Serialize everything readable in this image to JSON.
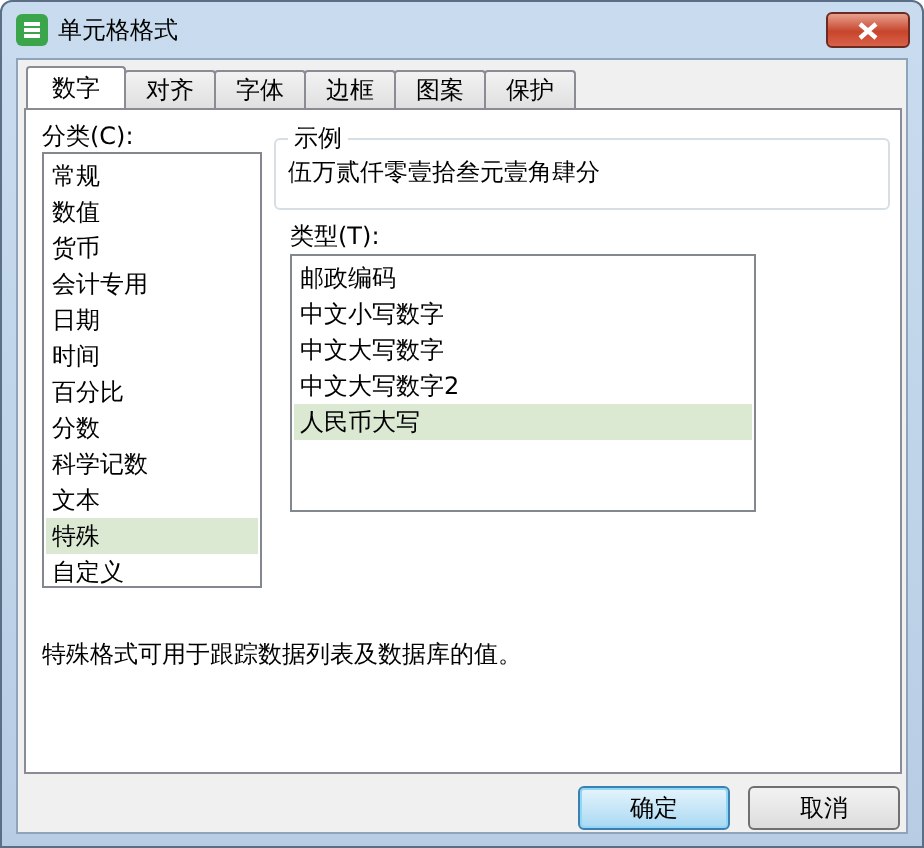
{
  "window": {
    "title": "单元格格式"
  },
  "tabs": [
    {
      "label": "数字",
      "selected": true
    },
    {
      "label": "对齐",
      "selected": false
    },
    {
      "label": "字体",
      "selected": false
    },
    {
      "label": "边框",
      "selected": false
    },
    {
      "label": "图案",
      "selected": false
    },
    {
      "label": "保护",
      "selected": false
    }
  ],
  "category": {
    "label": "分类(C):",
    "items": [
      {
        "label": "常规",
        "selected": false
      },
      {
        "label": "数值",
        "selected": false
      },
      {
        "label": "货币",
        "selected": false
      },
      {
        "label": "会计专用",
        "selected": false
      },
      {
        "label": "日期",
        "selected": false
      },
      {
        "label": "时间",
        "selected": false
      },
      {
        "label": "百分比",
        "selected": false
      },
      {
        "label": "分数",
        "selected": false
      },
      {
        "label": "科学记数",
        "selected": false
      },
      {
        "label": "文本",
        "selected": false
      },
      {
        "label": "特殊",
        "selected": true
      },
      {
        "label": "自定义",
        "selected": false
      }
    ]
  },
  "sample": {
    "legend": "示例",
    "value": "伍万贰仟零壹拾叁元壹角肆分"
  },
  "type": {
    "label": "类型(T):",
    "items": [
      {
        "label": "邮政编码",
        "selected": false
      },
      {
        "label": "中文小写数字",
        "selected": false
      },
      {
        "label": "中文大写数字",
        "selected": false
      },
      {
        "label": "中文大写数字2",
        "selected": false
      },
      {
        "label": "人民币大写",
        "selected": true
      }
    ]
  },
  "description": "特殊格式可用于跟踪数据列表及数据库的值。",
  "buttons": [
    {
      "label": "确定",
      "default": true
    },
    {
      "label": "取消",
      "default": false
    }
  ]
}
